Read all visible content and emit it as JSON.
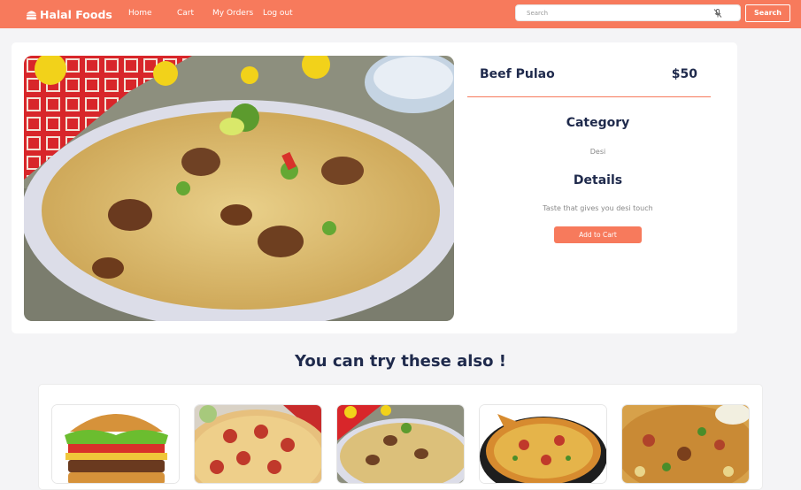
{
  "navbar": {
    "brand": "Halal Foods",
    "links": [
      "Home",
      "Cart",
      "My Orders",
      "Log out"
    ],
    "search_placeholder": "Search",
    "search_button": "Search"
  },
  "product": {
    "name": "Beef Pulao",
    "price": "$50",
    "category_heading": "Category",
    "category": "Desi",
    "details_heading": "Details",
    "details": "Taste that gives you desi touch",
    "add_to_cart": "Add to Cart"
  },
  "suggestions": {
    "title": "You can try these also !",
    "items": [
      "burger",
      "pepperoni-pizza",
      "beef-pulao",
      "pan-pizza",
      "biryani"
    ]
  },
  "colors": {
    "accent": "#f77a5c",
    "heading": "#1f2a4c",
    "background": "#f4f4f6"
  }
}
